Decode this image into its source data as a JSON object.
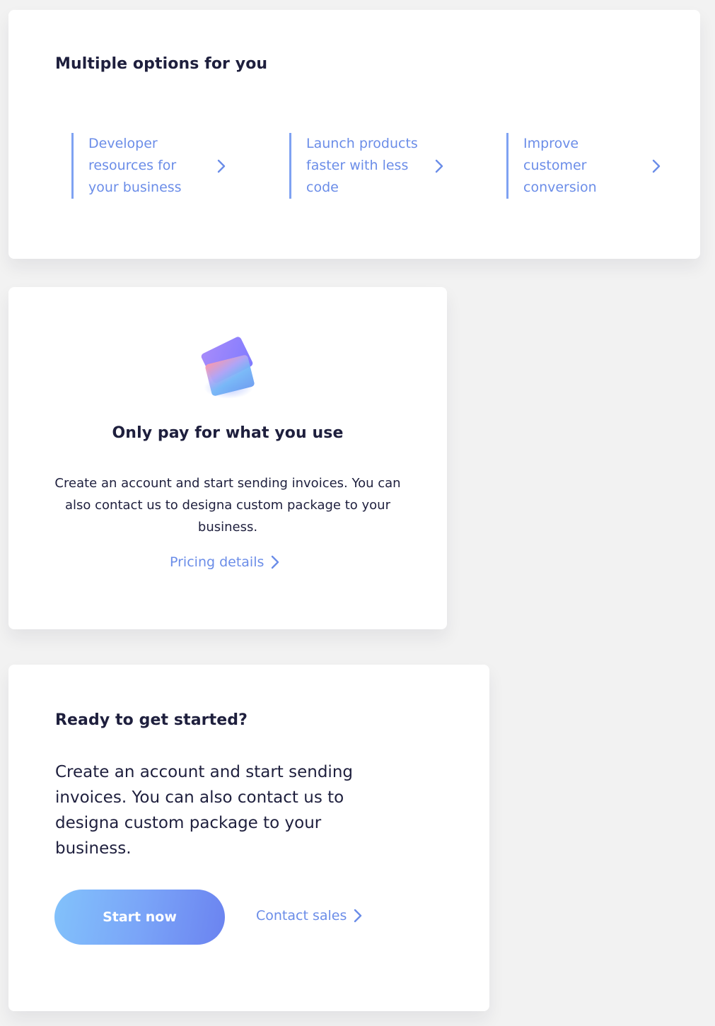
{
  "options_card": {
    "title": "Multiple options for you",
    "items": [
      {
        "label": "Developer resources for your business",
        "icon": "chevron-right-icon"
      },
      {
        "label": "Launch products faster with less code",
        "icon": "chevron-right-icon"
      },
      {
        "label": "Improve customer conversion",
        "icon": "chevron-right-icon"
      }
    ]
  },
  "pricing_card": {
    "illustration": "credit-cards-icon",
    "title": "Only pay for what you use",
    "description": "Create an account and start sending invoices. You can also contact us to designa custom package to your business.",
    "link_label": "Pricing details"
  },
  "cta_card": {
    "title": "Ready to get started?",
    "description": "Create an account and start sending invoices. You can also contact us to designa custom package to your business.",
    "primary_button": "Start now",
    "secondary_link": "Contact sales"
  },
  "colors": {
    "background": "#f2f2f2",
    "card": "#ffffff",
    "heading": "#1e1f3d",
    "accent_link": "#6b8de8",
    "accent_border": "#7fa2f2",
    "button_gradient_start": "#82c2fb",
    "button_gradient_end": "#6b83f0"
  }
}
